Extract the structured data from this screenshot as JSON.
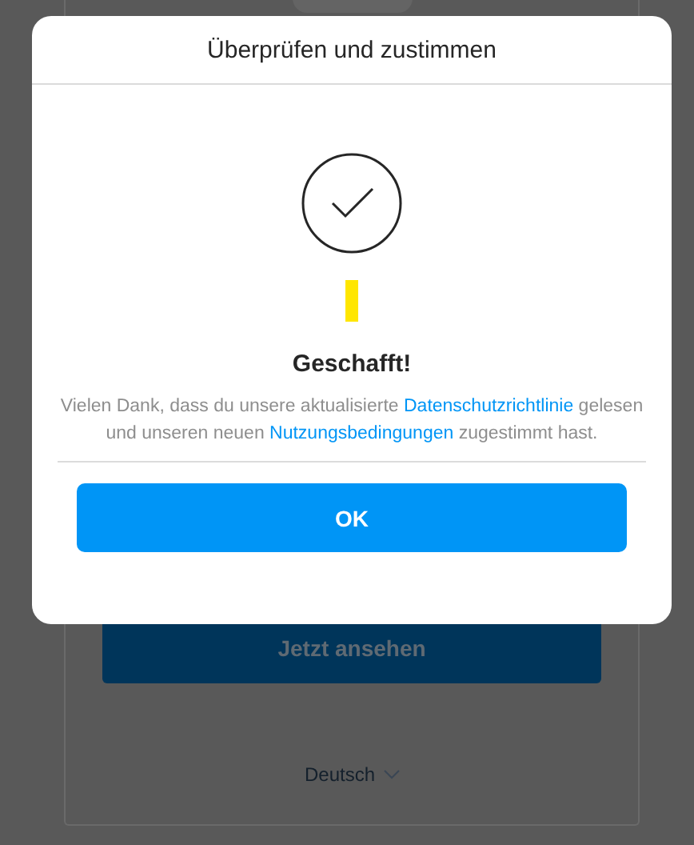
{
  "background": {
    "button": "Jetzt ansehen",
    "language": "Deutsch"
  },
  "dialog": {
    "title": "Überprüfen und zustimmen",
    "heading": "Geschafft!",
    "message": [
      {
        "kind": "text",
        "text": "Vielen Dank, dass du unsere aktualisierte "
      },
      {
        "kind": "link",
        "text": "Datenschutzrichtlinie"
      },
      {
        "kind": "text",
        "text": " gelesen und unseren neuen "
      },
      {
        "kind": "link",
        "text": "Nutzungsbedingungen"
      },
      {
        "kind": "text",
        "text": " zugestimmt hast."
      }
    ],
    "button": "OK"
  }
}
